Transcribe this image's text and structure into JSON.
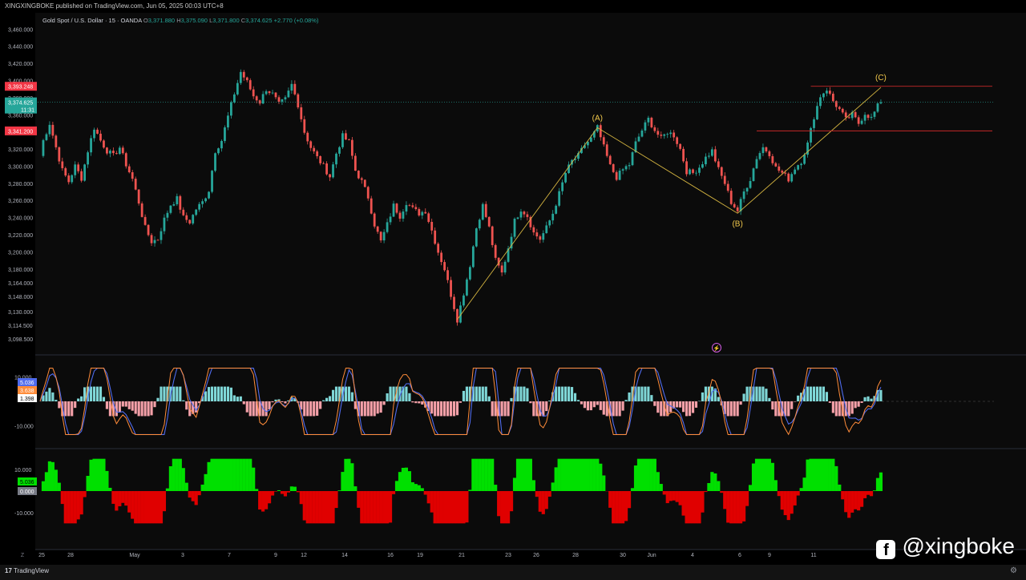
{
  "header": {
    "publish_line": "XINGXINGBOKE published on TradingView.com, Jun 05, 2025 00:03 UTC+8",
    "symbol": "Gold Spot / U.S. Dollar · 15 · OANDA",
    "ohlc": [
      {
        "label": "O",
        "value": "3,371.880"
      },
      {
        "label": "H",
        "value": "3,375.090"
      },
      {
        "label": "L",
        "value": "3,371.800"
      },
      {
        "label": "C",
        "value": "3,374.625"
      }
    ],
    "change": "+2.770 (+0.08%)"
  },
  "colors": {
    "up": "#26a69a",
    "down": "#ef5350",
    "wave": "#d4b440",
    "level": "#c62828",
    "green_hist": "#00e000",
    "red_hist": "#e00000",
    "osc_fast": "#ff8c3a",
    "osc_slow": "#4f6bed",
    "osc_hist_pos": "#7fd7d7",
    "osc_hist_neg": "#f4a0a8"
  },
  "chart_data": [
    {
      "type": "candlestick",
      "title": "Gold Spot / U.S. Dollar · 15 · OANDA",
      "ylim": [
        3090,
        3465
      ],
      "y_ticks": [
        "3,460.000",
        "3,440.000",
        "3,420.000",
        "3,400.000",
        "3,380.000",
        "3,360.000",
        "3,340.000",
        "3,320.000",
        "3,300.000",
        "3,280.000",
        "3,260.000",
        "3,240.000",
        "3,220.000",
        "3,200.000",
        "3,180.000",
        "3,164.000",
        "3,148.000",
        "3,130.000",
        "3,114.500",
        "3,098.500"
      ],
      "x_ticks": [
        "25",
        "28",
        "May",
        "3",
        "7",
        "9",
        "12",
        "14",
        "16",
        "19",
        "21",
        "23",
        "26",
        "28",
        "30",
        "Jun",
        "4",
        "6",
        "9",
        "11"
      ],
      "price_path": [
        [
          0,
          3312
        ],
        [
          1,
          3330
        ],
        [
          3,
          3350
        ],
        [
          5,
          3322
        ],
        [
          7,
          3295
        ],
        [
          9,
          3282
        ],
        [
          11,
          3300
        ],
        [
          13,
          3286
        ],
        [
          15,
          3318
        ],
        [
          17,
          3345
        ],
        [
          19,
          3330
        ],
        [
          21,
          3318
        ],
        [
          23,
          3312
        ],
        [
          25,
          3322
        ],
        [
          27,
          3302
        ],
        [
          29,
          3285
        ],
        [
          31,
          3258
        ],
        [
          33,
          3228
        ],
        [
          35,
          3212
        ],
        [
          37,
          3215
        ],
        [
          39,
          3238
        ],
        [
          41,
          3255
        ],
        [
          43,
          3262
        ],
        [
          45,
          3240
        ],
        [
          47,
          3235
        ],
        [
          49,
          3250
        ],
        [
          51,
          3258
        ],
        [
          53,
          3272
        ],
        [
          55,
          3318
        ],
        [
          57,
          3330
        ],
        [
          59,
          3358
        ],
        [
          61,
          3385
        ],
        [
          63,
          3410
        ],
        [
          65,
          3398
        ],
        [
          67,
          3382
        ],
        [
          69,
          3375
        ],
        [
          71,
          3390
        ],
        [
          73,
          3384
        ],
        [
          75,
          3372
        ],
        [
          77,
          3378
        ],
        [
          79,
          3395
        ],
        [
          81,
          3372
        ],
        [
          83,
          3340
        ],
        [
          85,
          3322
        ],
        [
          87,
          3310
        ],
        [
          89,
          3300
        ],
        [
          91,
          3288
        ],
        [
          93,
          3315
        ],
        [
          95,
          3335
        ],
        [
          97,
          3328
        ],
        [
          99,
          3295
        ],
        [
          101,
          3282
        ],
        [
          103,
          3264
        ],
        [
          105,
          3232
        ],
        [
          107,
          3212
        ],
        [
          109,
          3232
        ],
        [
          111,
          3254
        ],
        [
          113,
          3242
        ],
        [
          115,
          3258
        ],
        [
          117,
          3250
        ],
        [
          119,
          3245
        ],
        [
          121,
          3248
        ],
        [
          123,
          3225
        ],
        [
          125,
          3200
        ],
        [
          127,
          3180
        ],
        [
          129,
          3150
        ],
        [
          131,
          3121
        ],
        [
          133,
          3152
        ],
        [
          135,
          3185
        ],
        [
          137,
          3228
        ],
        [
          139,
          3254
        ],
        [
          141,
          3228
        ],
        [
          143,
          3190
        ],
        [
          145,
          3175
        ],
        [
          147,
          3205
        ],
        [
          149,
          3236
        ],
        [
          151,
          3250
        ],
        [
          153,
          3242
        ],
        [
          155,
          3222
        ],
        [
          157,
          3215
        ],
        [
          159,
          3228
        ],
        [
          161,
          3245
        ],
        [
          163,
          3268
        ],
        [
          165,
          3292
        ],
        [
          167,
          3306
        ],
        [
          169,
          3312
        ],
        [
          171,
          3325
        ],
        [
          173,
          3332
        ],
        [
          175,
          3345
        ],
        [
          177,
          3322
        ],
        [
          179,
          3300
        ],
        [
          181,
          3287
        ],
        [
          183,
          3296
        ],
        [
          185,
          3302
        ],
        [
          187,
          3327
        ],
        [
          189,
          3342
        ],
        [
          191,
          3355
        ],
        [
          193,
          3342
        ],
        [
          195,
          3332
        ],
        [
          197,
          3340
        ],
        [
          199,
          3336
        ],
        [
          201,
          3320
        ],
        [
          203,
          3294
        ],
        [
          205,
          3292
        ],
        [
          207,
          3299
        ],
        [
          209,
          3310
        ],
        [
          211,
          3318
        ],
        [
          213,
          3296
        ],
        [
          215,
          3280
        ],
        [
          217,
          3258
        ],
        [
          219,
          3248
        ],
        [
          221,
          3270
        ],
        [
          223,
          3285
        ],
        [
          225,
          3310
        ],
        [
          227,
          3322
        ],
        [
          229,
          3315
        ],
        [
          231,
          3298
        ],
        [
          233,
          3292
        ],
        [
          235,
          3285
        ],
        [
          237,
          3298
        ],
        [
          239,
          3306
        ],
        [
          241,
          3326
        ],
        [
          243,
          3358
        ],
        [
          245,
          3382
        ],
        [
          247,
          3390
        ],
        [
          249,
          3376
        ],
        [
          251,
          3366
        ],
        [
          253,
          3354
        ],
        [
          255,
          3360
        ],
        [
          257,
          3350
        ],
        [
          259,
          3362
        ],
        [
          261,
          3356
        ],
        [
          263,
          3370
        ],
        [
          264,
          3374.6
        ]
      ],
      "wave_labels": [
        {
          "label": "(A)",
          "price": 3345
        },
        {
          "label": "(B)",
          "price": 3245
        },
        {
          "label": "(C)",
          "price": 3392
        }
      ],
      "levels": [
        {
          "label": "3,393.248",
          "price": 3393.248
        },
        {
          "label": "3,341.200",
          "price": 3341.2
        }
      ],
      "last_price": {
        "label": "3,374.625",
        "countdown": "11:31",
        "price": 3374.625
      }
    },
    {
      "type": "line",
      "title": "",
      "y_ticks": [
        "10.000",
        "-10.000"
      ],
      "ylim": [
        -14,
        14
      ],
      "series": [
        {
          "value_label": "5.036",
          "color": "#4f6bed"
        },
        {
          "value_label": "3.638",
          "color": "#ff8c3a"
        },
        {
          "value_label": "1.398",
          "color": "#ffffff"
        }
      ]
    },
    {
      "type": "histogram",
      "title": "",
      "y_ticks": [
        "10.000",
        "-10.000"
      ],
      "ylim": [
        -16,
        16
      ],
      "value_labels": [
        "5.036",
        "0.000"
      ]
    }
  ],
  "watermark": "@xingboke",
  "footer": {
    "logo_text": "TradingView",
    "logo_mark": "17",
    "left_corner": "Z"
  }
}
